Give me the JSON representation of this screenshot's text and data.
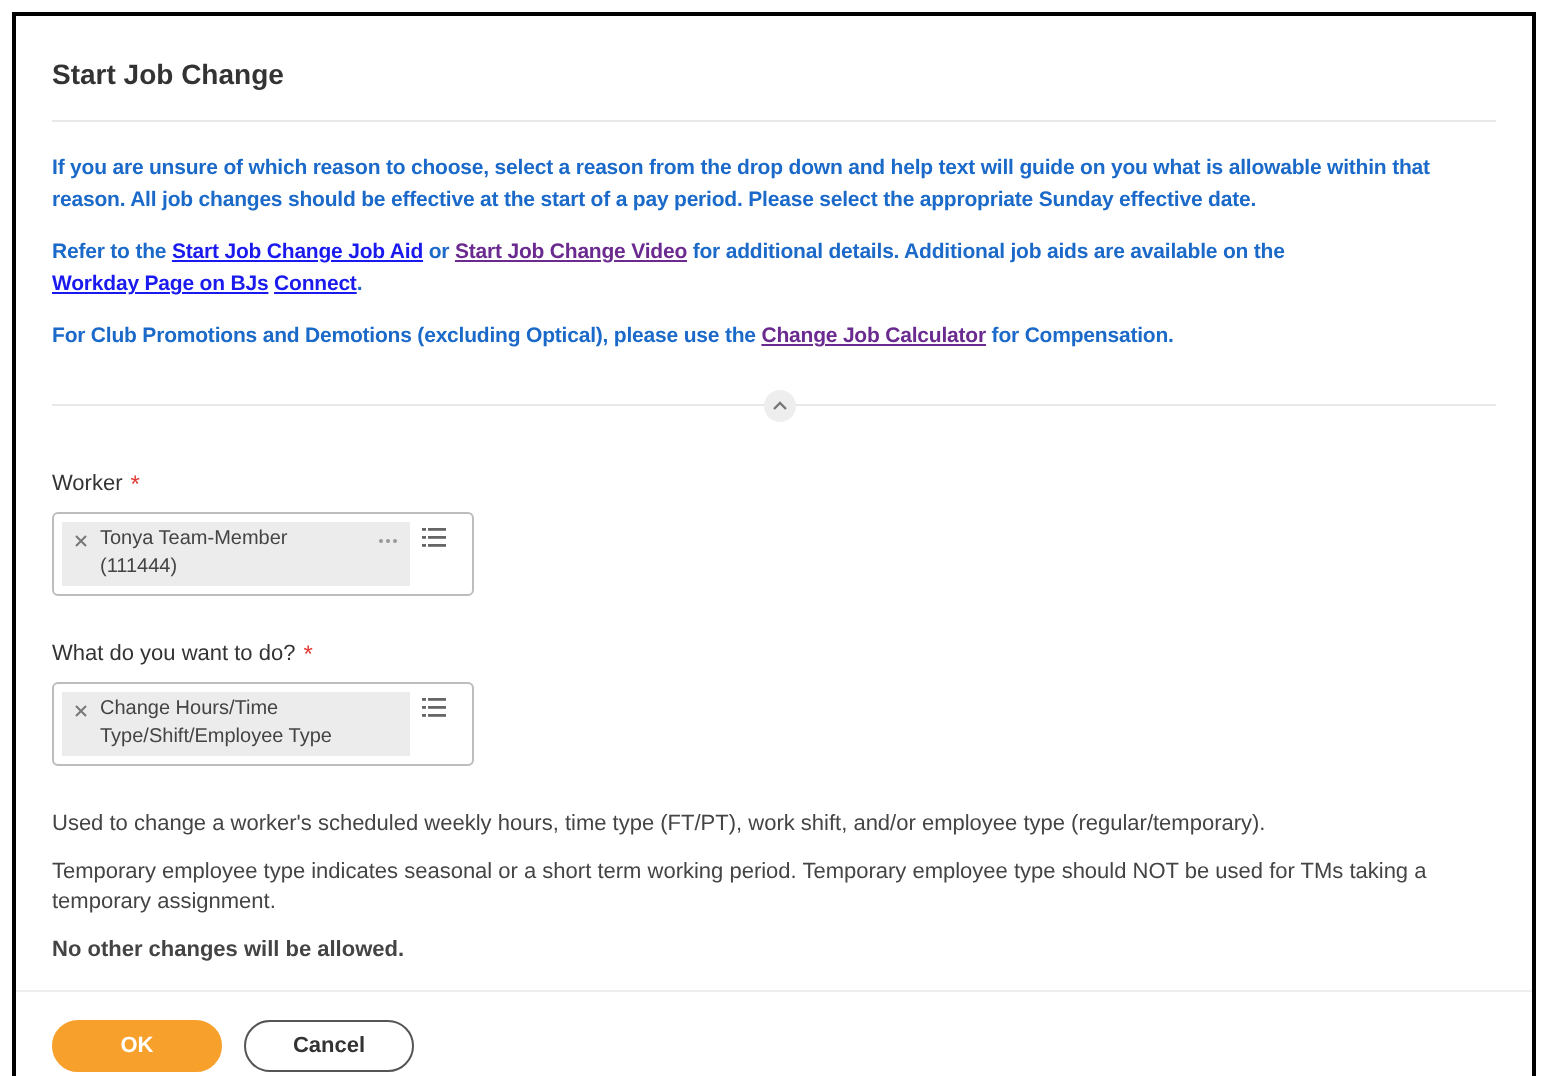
{
  "title": "Start Job Change",
  "instructions": [
    [
      {
        "text": "If you are unsure of which reason to choose, select a reason from the drop down and help text will guide on you what is allowable within that reason. All job changes should be effective at the start of a pay period.  Please select the appropriate Sunday effective date."
      }
    ],
    [
      {
        "text": "Refer to the "
      },
      {
        "link": "Start Job Change Job Aid",
        "visited": false
      },
      {
        "text": " or "
      },
      {
        "link": "Start Job Change Video",
        "visited": true
      },
      {
        "text": " for additional details.  Additional job aids are available on the "
      },
      {
        "link": "Workday Page on BJs",
        "visited": false
      },
      {
        "link": "Connect",
        "visited": false
      },
      {
        "text": "."
      }
    ],
    [
      {
        "text": "For Club Promotions and Demotions (excluding Optical), please use the "
      },
      {
        "link": "Change Job Calculator",
        "visited": true
      },
      {
        "text": " for Compensation."
      }
    ]
  ],
  "section_expanded": true,
  "fields": [
    {
      "label": "Worker",
      "required_mark": "*",
      "value": "Tonya Team-Member (111444)",
      "has_more": true
    },
    {
      "label": "What do you want to do?",
      "required_mark": "*",
      "value": "Change Hours/Time Type/Shift/Employee Type",
      "has_more": false
    }
  ],
  "help": [
    {
      "text": "Used to change a worker's scheduled weekly hours, time type (FT/PT), work shift, and/or employee type (regular/temporary).",
      "bold": false
    },
    {
      "text": "Temporary employee type indicates seasonal or a short term working period. Temporary employee type should NOT be used for TMs taking a temporary assignment.",
      "bold": false
    },
    {
      "text": "No other changes will be allowed.",
      "bold": true
    }
  ],
  "buttons": [
    {
      "label": "OK",
      "kind": "primary"
    },
    {
      "label": "Cancel",
      "kind": "secondary"
    }
  ]
}
